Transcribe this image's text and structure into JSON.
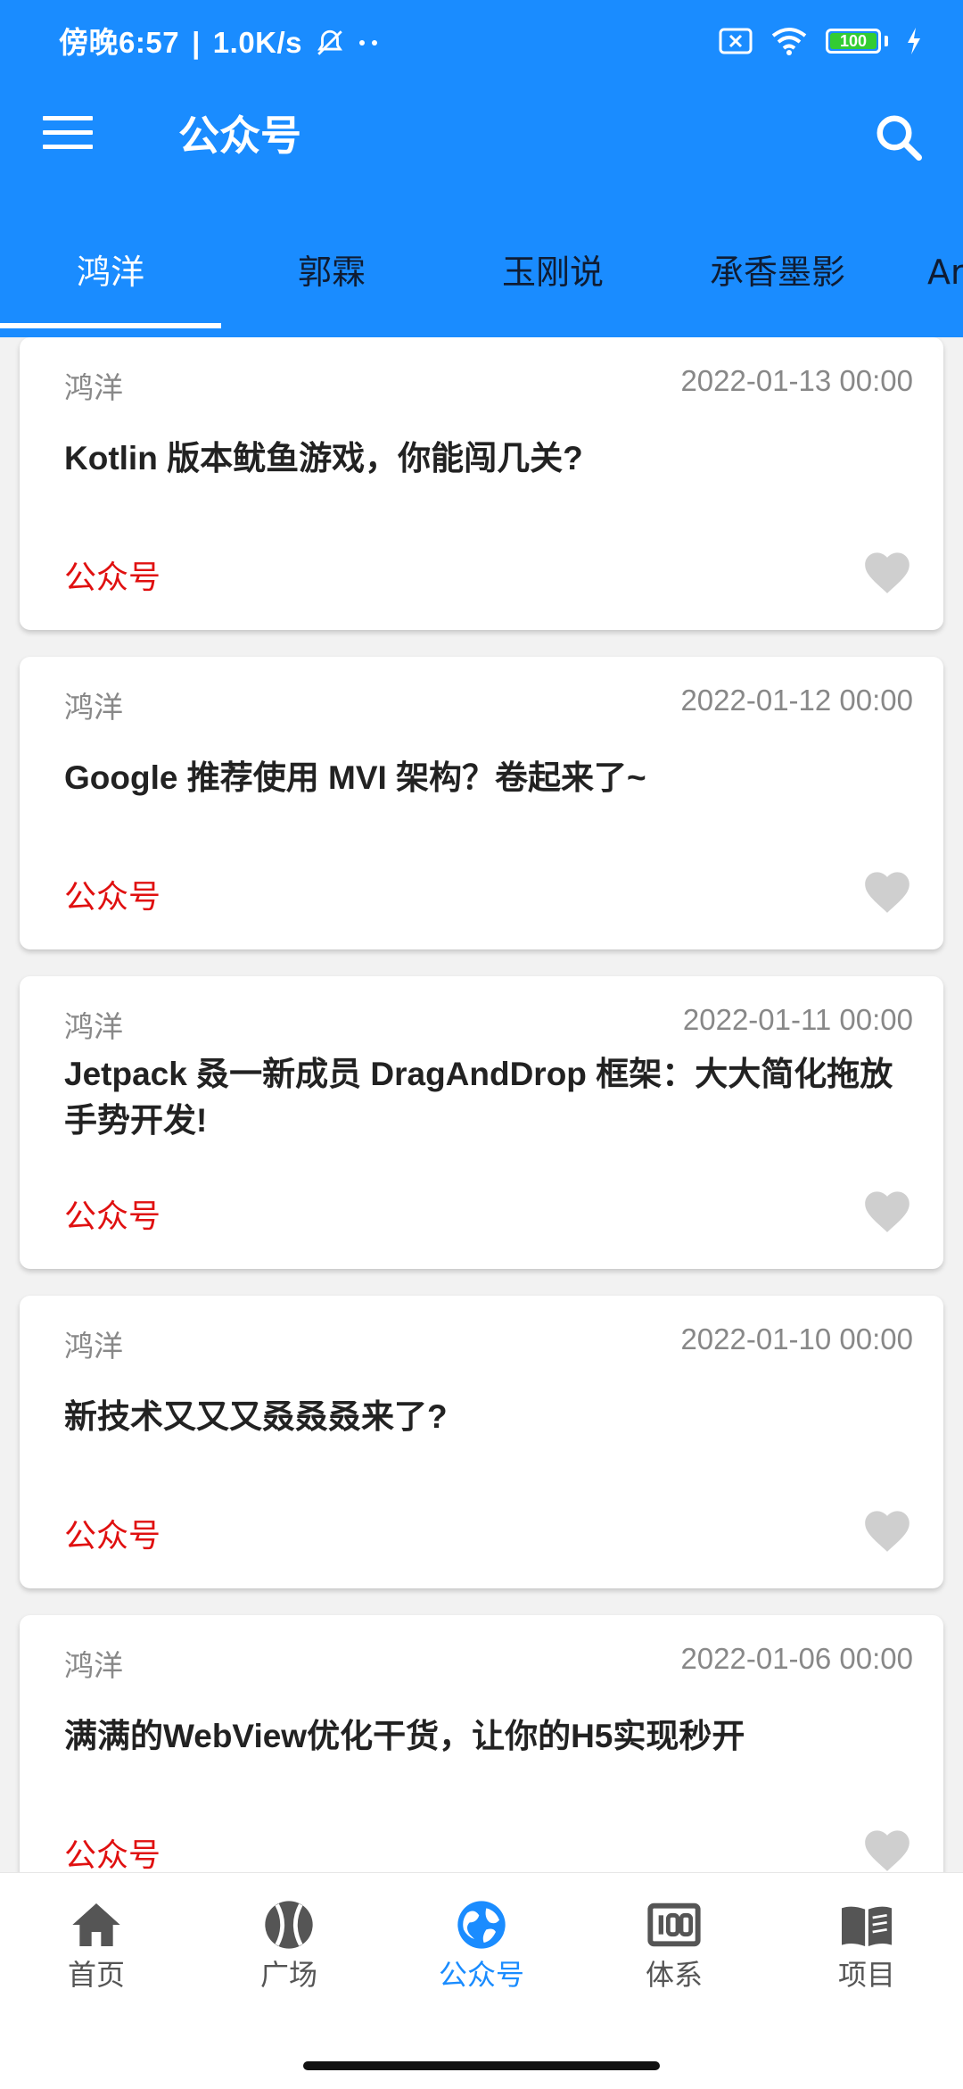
{
  "status_bar": {
    "time": "傍晚6:57",
    "speed": "1.0K/s",
    "battery": "100",
    "battery_level": 1.0,
    "icons": [
      "mute-bell-icon",
      "dots-icon",
      "sim-x-icon",
      "wifi-icon",
      "battery-icon",
      "charging-icon"
    ]
  },
  "toolbar": {
    "title": "公众号",
    "menu_icon": "menu-icon",
    "search_icon": "search-icon"
  },
  "tabs": [
    {
      "label": "鸿洋",
      "active": true
    },
    {
      "label": "郭霖",
      "active": false
    },
    {
      "label": "玉刚说",
      "active": false
    },
    {
      "label": "承香墨影",
      "active": false
    },
    {
      "label": "Ar",
      "active": false
    }
  ],
  "articles": [
    {
      "author": "鸿洋",
      "date": "2022-01-13 00:00",
      "title": "Kotlin 版本鱿鱼游戏，你能闯几关?",
      "tag": "公众号"
    },
    {
      "author": "鸿洋",
      "date": "2022-01-12 00:00",
      "title": "Google 推荐使用 MVI 架构？卷起来了~",
      "tag": "公众号"
    },
    {
      "author": "鸿洋",
      "date": "2022-01-11 00:00",
      "title": "Jetpack 叒一新成员 DragAndDrop 框架：大大简化拖放手势开发!",
      "tag": "公众号"
    },
    {
      "author": "鸿洋",
      "date": "2022-01-10 00:00",
      "title": "新技术又又又叒叒叒来了?",
      "tag": "公众号"
    },
    {
      "author": "鸿洋",
      "date": "2022-01-06 00:00",
      "title": "满满的WebView优化干货，让你的H5实现秒开",
      "tag": "公众号"
    }
  ],
  "bottom_nav": [
    {
      "label": "首页",
      "icon": "home-icon",
      "active": false
    },
    {
      "label": "广场",
      "icon": "ball-icon",
      "active": false
    },
    {
      "label": "公众号",
      "icon": "globe-icon",
      "active": true
    },
    {
      "label": "体系",
      "icon": "grid-100-icon",
      "active": false
    },
    {
      "label": "项目",
      "icon": "book-icon",
      "active": false
    }
  ],
  "colors": {
    "primary": "#1a8cff",
    "tag": "#e01010",
    "heart": "#cfcfcf",
    "background": "#f2f2f2"
  }
}
